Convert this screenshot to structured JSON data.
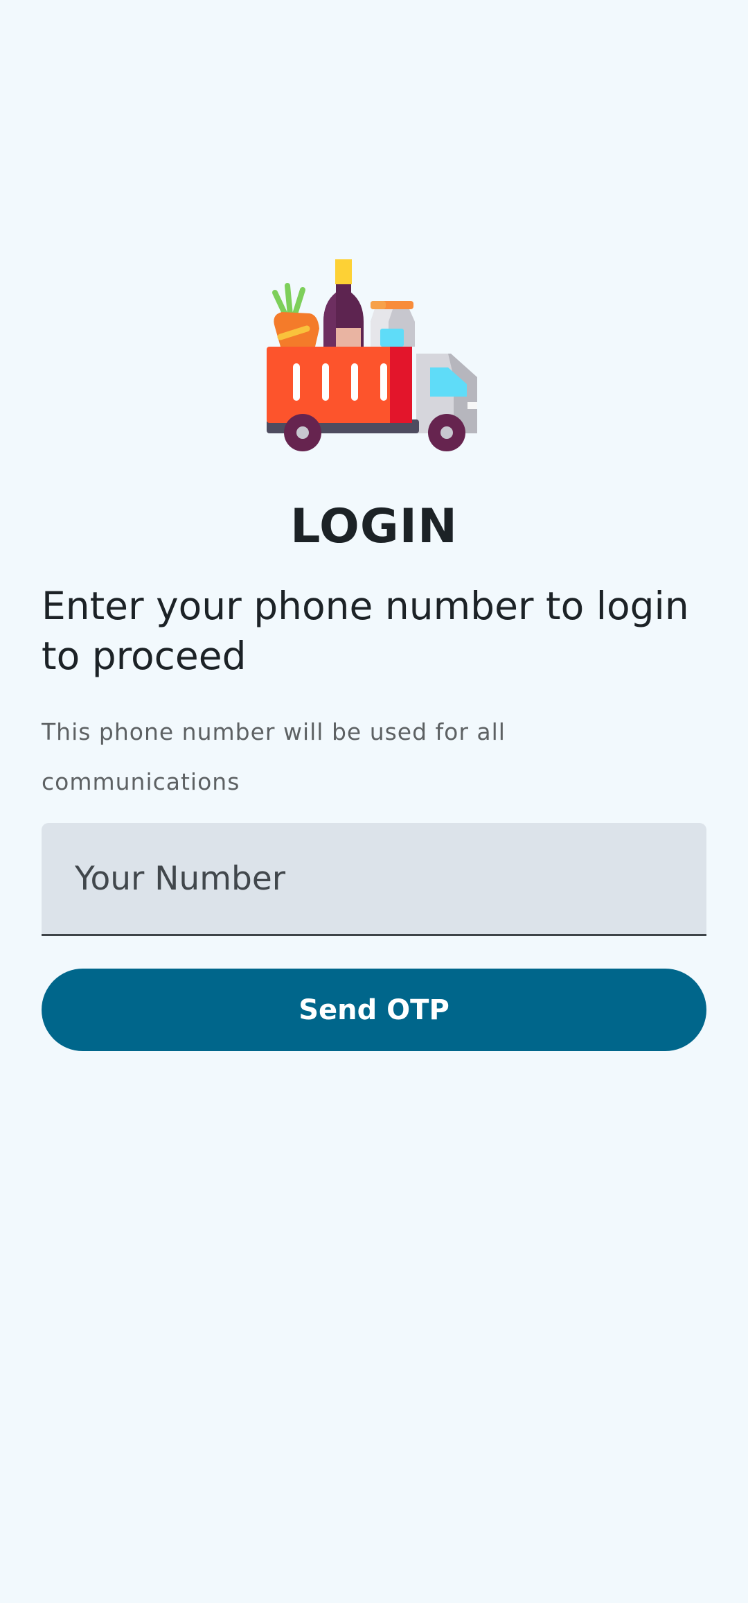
{
  "login": {
    "logo_icon": "grocery-delivery-truck-icon",
    "title": "LOGIN",
    "heading": "Enter your phone number to login to proceed",
    "subtext": "This phone number will be used for all communications",
    "phone_input": {
      "value": "",
      "placeholder": "Your Number"
    },
    "send_button_label": "Send OTP"
  },
  "colors": {
    "background": "#f2f9fd",
    "primary": "#00668b",
    "input_background": "#dce3ea",
    "text_dark": "#1c2226",
    "text_muted": "#5d6163"
  }
}
